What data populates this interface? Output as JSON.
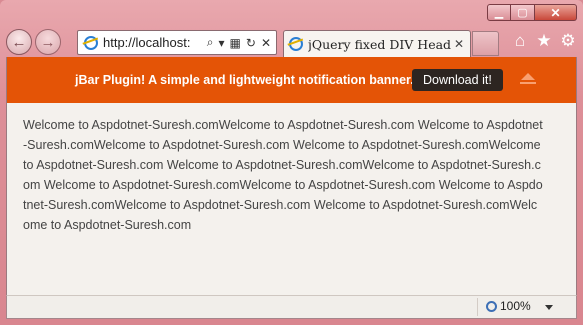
{
  "browser": {
    "address": "http://localhost:",
    "tab_title": "jQuery fixed DIV Header N...",
    "tab_close": "✕",
    "zoom_label": "100%"
  },
  "jbar": {
    "message": "jBar Plugin! A simple and lightweight notification banner.",
    "button_label": "Download it!",
    "background_color": "#e45406"
  },
  "content": {
    "text": "Welcome to Aspdotnet-Suresh.comWelcome to Aspdotnet-Suresh.com Welcome to Aspdotnet-Suresh.comWelcome to Aspdotnet-Suresh.com Welcome to Aspdotnet-Suresh.comWelcome to Aspdotnet-Suresh.com Welcome to Aspdotnet-Suresh.comWelcome to Aspdotnet-Suresh.com Welcome to Aspdotnet-Suresh.comWelcome to Aspdotnet-Suresh.com Welcome to Aspdotnet-Suresh.comWelcome to Aspdotnet-Suresh.com Welcome to Aspdotnet-Suresh.comWelcome to Aspdotnet-Suresh.com"
  }
}
